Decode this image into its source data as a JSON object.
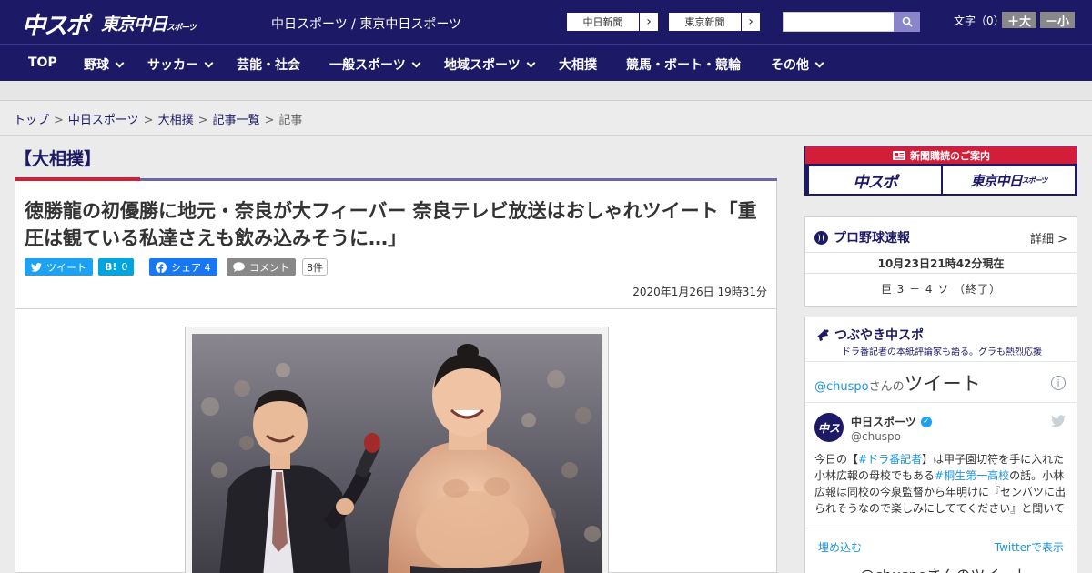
{
  "header": {
    "logo_chuspo": "中スポ",
    "logo_tokyo": "東京中日",
    "logo_tokyo_small": "スポーツ",
    "site_tag": "中日スポーツ / 東京中日スポーツ",
    "paper_buttons": [
      {
        "label": "中日新聞"
      },
      {
        "label": "東京新聞"
      }
    ],
    "search_placeholder": "",
    "font_size_label": "文字（0）",
    "font_plus": "＋大",
    "font_minus": "－小"
  },
  "nav": {
    "items": [
      {
        "label": "TOP",
        "dropdown": false
      },
      {
        "label": "野球",
        "dropdown": true
      },
      {
        "label": "サッカー",
        "dropdown": true
      },
      {
        "label": "芸能・社会",
        "dropdown": false
      },
      {
        "label": "一般スポーツ",
        "dropdown": true
      },
      {
        "label": "地域スポーツ",
        "dropdown": true
      },
      {
        "label": "大相撲",
        "dropdown": false
      },
      {
        "label": "競馬・ボート・競輪",
        "dropdown": false
      },
      {
        "label": "その他",
        "dropdown": true
      }
    ]
  },
  "breadcrumb": {
    "items": [
      "トップ",
      "中日スポーツ",
      "大相撲",
      "記事一覧"
    ],
    "current": "記事"
  },
  "article": {
    "category": "【大相撲】",
    "headline": "徳勝龍の初優勝に地元・奈良が大フィーバー 奈良テレビ放送はおしゃれツイート「重圧は観ている私達さえも飲み込みそうに…」",
    "share": {
      "tweet": "ツイート",
      "hatena_icon": "B!",
      "hatena_count": "0",
      "facebook": "シェア 4",
      "comment": "コメント",
      "comment_count": "8件"
    },
    "date": "2020年1月26日 19時31分"
  },
  "sidebar": {
    "subscribe": {
      "title": "新聞購読のご案内",
      "logo_left": "中スポ",
      "logo_right": "東京中日",
      "logo_right_small": "スポーツ"
    },
    "baseball": {
      "title": "プロ野球速報",
      "detail": "詳細 >",
      "time": "10月23日21時42分現在",
      "score": "巨 3 － 4 ソ （終了）"
    },
    "tweets": {
      "title": "つぶやき中スポ",
      "subtitle": "ドラ番記者の本紙評論家も語る。グラも熱烈応援",
      "widget_handle": "@chuspo",
      "widget_san": "さんの",
      "widget_title": "ツイート",
      "account_name": "中日スポーツ",
      "account_handle": "@chuspo",
      "tweet_pre": "今日の【",
      "tweet_tag1": "#ドラ番記者",
      "tweet_mid1": "】は甲子園切符を手に入れた小林広報の母校でもある",
      "tweet_tag2": "#桐生第一高校",
      "tweet_post": "の話。小林広報は同校の今泉監督から年明けに『センバツに出られそうなので楽しみにしててください』と聞いていた",
      "embed": "埋め込む",
      "view_on_twitter": "Twitterで表示",
      "next_title": "@chuspoさんのツイート"
    }
  },
  "colors": {
    "brand_navy": "#1c1a66",
    "accent_red": "#d21e38",
    "twitter_blue": "#1da1f2",
    "facebook_blue": "#1877f2",
    "hatena_blue": "#00a4de"
  }
}
